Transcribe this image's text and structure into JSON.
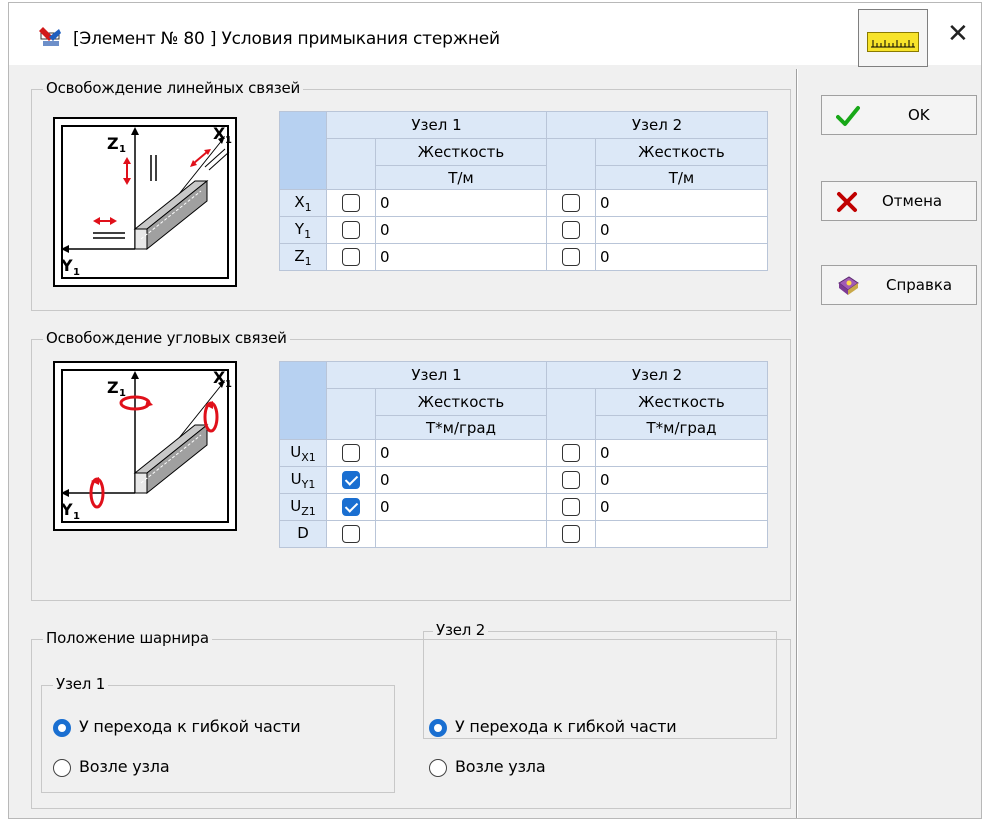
{
  "window": {
    "title": "[Элемент № 80 ] Условия примыкания стержней",
    "close_label": "✕",
    "ruler_icon": "ruler-icon"
  },
  "buttons": {
    "ok": "OK",
    "cancel": "Отмена",
    "help": "Справка"
  },
  "linear": {
    "legend": "Освобождение линейных связей",
    "node1": "Узел 1",
    "node2": "Узел 2",
    "stiffness": "Жесткость",
    "unit": "Т/м",
    "rows": [
      {
        "label": "X",
        "sub": "1",
        "n1_checked": false,
        "n1_value": "0",
        "n2_checked": false,
        "n2_value": "0"
      },
      {
        "label": "Y",
        "sub": "1",
        "n1_checked": false,
        "n1_value": "0",
        "n2_checked": false,
        "n2_value": "0"
      },
      {
        "label": "Z",
        "sub": "1",
        "n1_checked": false,
        "n1_value": "0",
        "n2_checked": false,
        "n2_value": "0"
      }
    ]
  },
  "angular": {
    "legend": "Освобождение угловых связей",
    "node1": "Узел 1",
    "node2": "Узел 2",
    "stiffness": "Жесткость",
    "unit": "Т*м/град",
    "rows": [
      {
        "label": "U",
        "sub": "X1",
        "n1_checked": false,
        "n1_value": "0",
        "n2_checked": false,
        "n2_value": "0"
      },
      {
        "label": "U",
        "sub": "Y1",
        "n1_checked": true,
        "n1_value": "0",
        "n2_checked": false,
        "n2_value": "0"
      },
      {
        "label": "U",
        "sub": "Z1",
        "n1_checked": true,
        "n1_value": "0",
        "n2_checked": false,
        "n2_value": "0"
      },
      {
        "label": "D",
        "sub": "",
        "n1_checked": false,
        "n1_value": "",
        "n2_checked": false,
        "n2_value": ""
      }
    ]
  },
  "hinge": {
    "legend": "Положение шарнира",
    "node1_legend": "Узел 1",
    "node2_legend": "Узел 2",
    "node1_options": [
      {
        "label": "У перехода к гибкой части",
        "selected": true
      },
      {
        "label": "Возле узла",
        "selected": false
      }
    ],
    "node2_options": [
      {
        "label": "У перехода к гибкой части",
        "selected": true
      },
      {
        "label": "Возле узла",
        "selected": false
      }
    ]
  },
  "diagram_labels": {
    "z": "Z",
    "x": "X",
    "y": "Y",
    "sub": "1"
  },
  "colors": {
    "accent": "#1a6fd1",
    "red_arrow": "#e0101a",
    "ok_green": "#18a818",
    "cancel_red": "#c00000",
    "header_bg": "#dce8f7"
  }
}
